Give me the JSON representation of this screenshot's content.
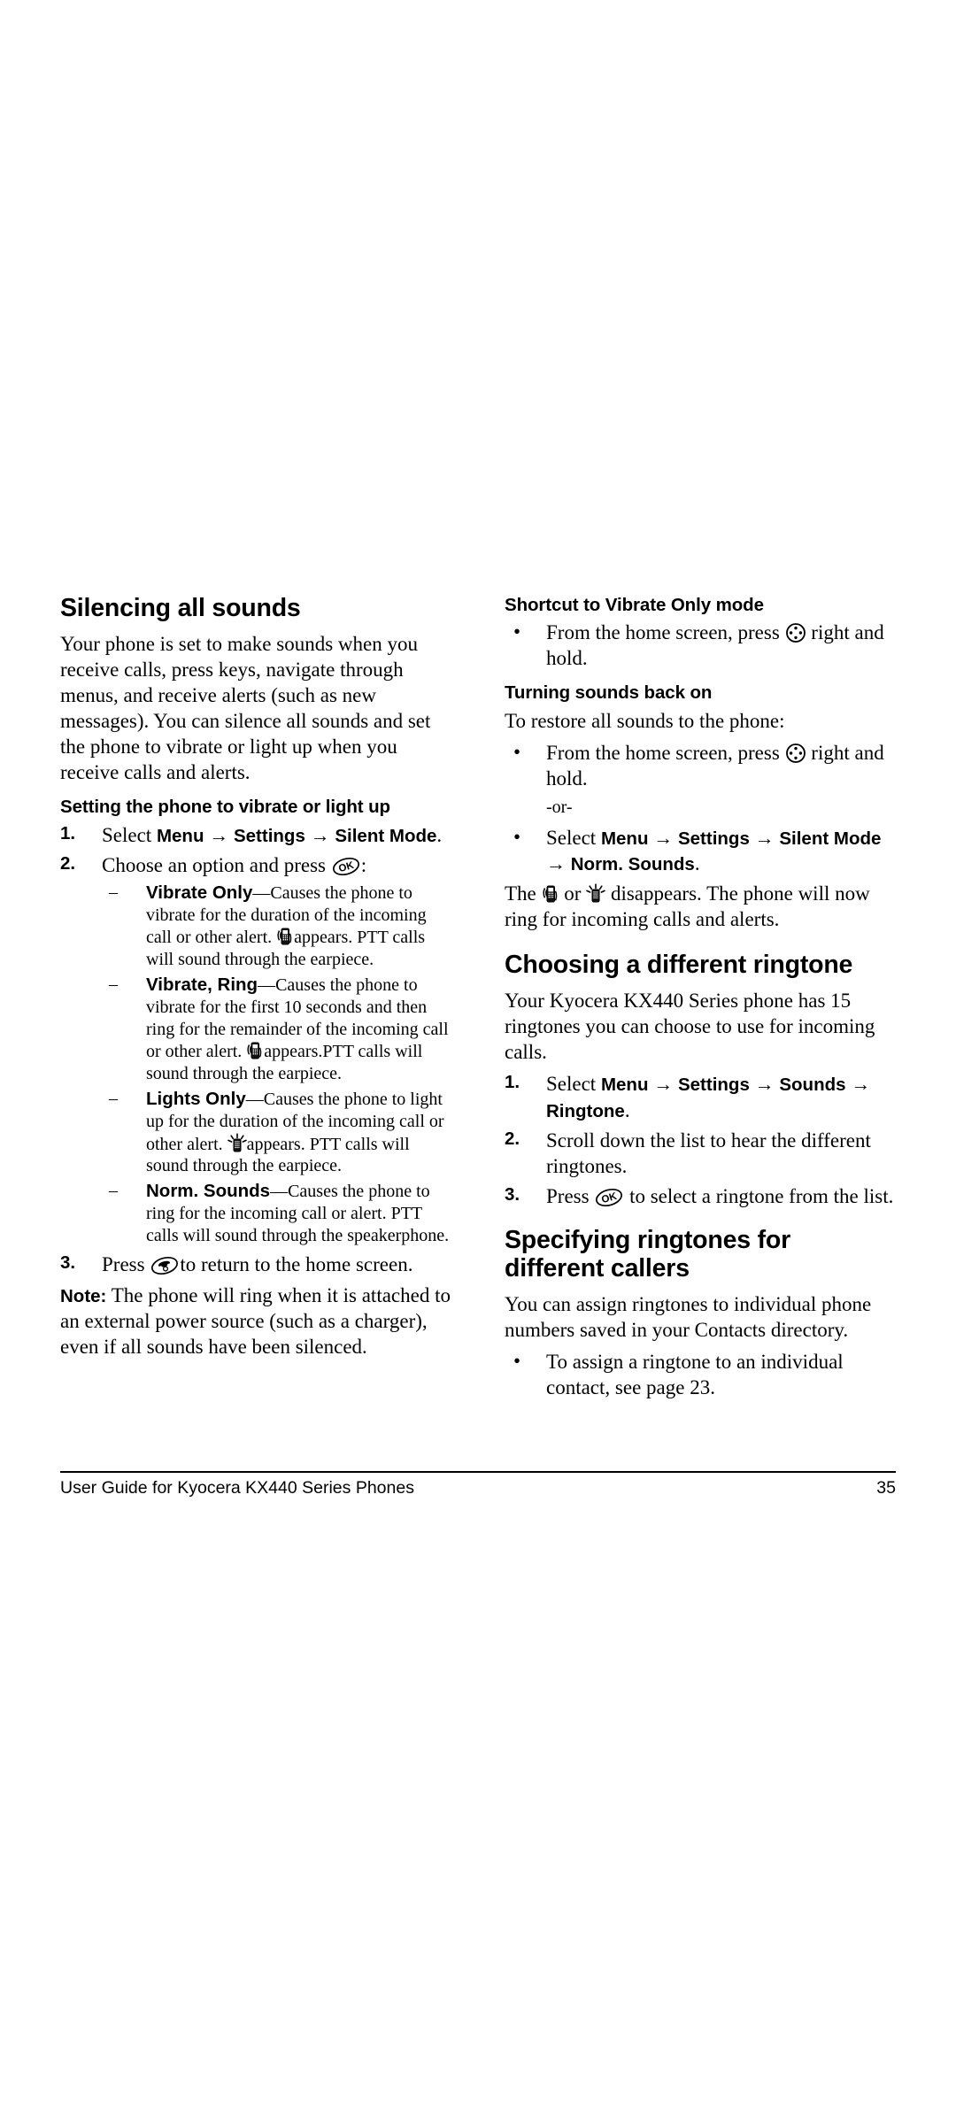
{
  "document": {
    "title": "User Guide for Kyocera KX440 Series Phones",
    "page_number": "35"
  },
  "left_column": {
    "heading": "Silencing all sounds",
    "intro": "Your phone is set to make sounds when you receive calls, press keys, navigate through menus, and receive alerts (such as new messages). You can silence all sounds and set the phone to vibrate or light up when you receive calls and alerts.",
    "subheading": "Setting the phone to vibrate or light up",
    "step1": {
      "num": "1.",
      "lead": "Select",
      "path": [
        "Menu",
        "Settings",
        "Silent Mode"
      ],
      "trailing": "."
    },
    "step2": {
      "num": "2.",
      "text_before": "Choose an option and press",
      "icon": "ok-key-icon",
      "text_after": ":"
    },
    "options": [
      {
        "dash": "–",
        "term": "Vibrate Only",
        "dash_sep": "—",
        "text_a": "Causes the phone to vibrate for the duration of the incoming call or other alert.",
        "icon": "vibrate-phone-icon",
        "text_b": "appears. PTT calls will sound through the earpiece."
      },
      {
        "dash": "–",
        "term": "Vibrate, Ring",
        "dash_sep": "—",
        "text_a": "Causes the phone to vibrate for the first 10 seconds and then ring for the remainder of the incoming call or other alert.",
        "icon": "vibrate-phone-icon",
        "text_b": "appears.PTT calls will sound through the earpiece."
      },
      {
        "dash": "–",
        "term": "Lights Only",
        "dash_sep": "—",
        "text_a": "Causes the phone to light up for the duration of the incoming call or other alert.",
        "icon": "lights-phone-icon",
        "text_b": "appears. PTT calls will sound through the earpiece."
      },
      {
        "dash": "–",
        "term": "Norm. Sounds",
        "dash_sep": "—",
        "text_a": "Causes the phone to ring for the incoming call or alert. PTT calls will sound through the speakerphone.",
        "icon": "",
        "text_b": ""
      }
    ],
    "step3": {
      "num": "3.",
      "text_before": "Press",
      "icon": "end-key-icon",
      "text_after": "to return to the home screen."
    },
    "note": {
      "label": "Note:",
      "text": "The phone will ring when it is attached to an external power source (such as a charger), even if all sounds have been silenced."
    }
  },
  "right_column": {
    "shortcut_heading": "Shortcut to Vibrate Only mode",
    "shortcut_bullet": {
      "bullet": "•",
      "text_before": "From the home screen, press",
      "icon": "nav-key-icon",
      "text_after": "right and hold."
    },
    "turning_heading": "Turning sounds back on",
    "turning_intro": "To restore all sounds to the phone:",
    "turning_bullet1": {
      "bullet": "•",
      "text_before": "From the home screen, press",
      "icon": "nav-key-icon",
      "text_after": "right and hold."
    },
    "or_text": "-or-",
    "turning_bullet2": {
      "bullet": "•",
      "lead": "Select",
      "path": [
        "Menu",
        "Settings",
        "Silent Mode",
        "Norm. Sounds"
      ],
      "trailing": "."
    },
    "disappear_text": {
      "a": "The",
      "icon1": "vibrate-phone-icon",
      "b": "or",
      "icon2": "lights-phone-icon",
      "c": "disappears. The phone will now ring for incoming calls and alerts."
    },
    "ringtone_heading": "Choosing a different ringtone",
    "ringtone_intro": "Your Kyocera KX440 Series phone has 15 ringtones you can choose to use for incoming calls.",
    "ringtone_step1": {
      "num": "1.",
      "lead": "Select",
      "path": [
        "Menu",
        "Settings",
        "Sounds",
        "Ringtone"
      ],
      "trailing": "."
    },
    "ringtone_step2": {
      "num": "2.",
      "text": "Scroll down the list to hear the different ringtones."
    },
    "ringtone_step3": {
      "num": "3.",
      "text_before": "Press",
      "icon": "ok-key-icon",
      "text_after": "to select a ringtone from the list."
    },
    "specify_heading_line1": "Specifying ringtones for",
    "specify_heading_line2": "different callers",
    "specify_intro": "You can assign ringtones to individual phone numbers saved in your Contacts directory.",
    "specify_bullet": {
      "bullet": "•",
      "text": "To assign a ringtone to an individual contact, see page 23."
    }
  },
  "colors": {
    "text": "#000000",
    "background": "#ffffff",
    "rule": "#000000"
  }
}
